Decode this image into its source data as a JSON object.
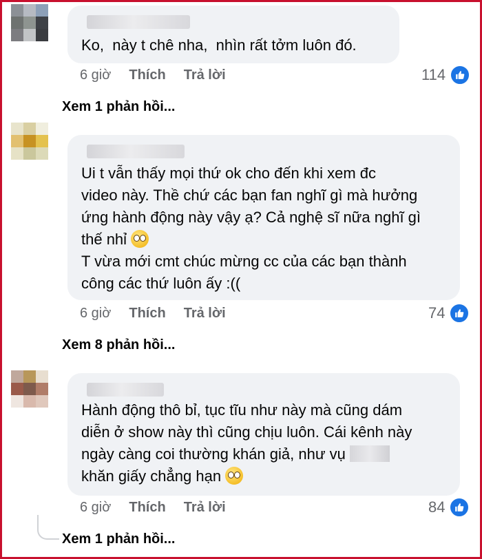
{
  "comments": [
    {
      "text": "Ko,  này t chê nha,  nhìn rất tởm luôn đó.",
      "time": "6 giờ",
      "like": "Thích",
      "reply": "Trả lời",
      "reaction_count": "114",
      "view_replies": "Xem 1 phản hồi..."
    },
    {
      "text": "Ui t vẫn thấy mọi thứ ok cho đến khi xem đc\nvideo này. Thề chứ các bạn fan nghĩ gì mà hưởng\nứng hành động này vậy ạ? Cả nghệ sĩ nữa nghĩ gì\nthế nhỉ",
      "text_line2": "T vừa mới cmt chúc mừng cc của các bạn thành\ncông các thứ luôn ấy :((",
      "emoji": "pleading-face-emoji",
      "time": "6 giờ",
      "like": "Thích",
      "reply": "Trả lời",
      "reaction_count": "74",
      "view_replies": "Xem 8 phản hồi..."
    },
    {
      "text_a": "Hành động thô bỉ, tục tĩu như này mà cũng dám\ndiễn ở show này thì cũng chịu luôn. Cái kênh này\nngày càng coi thường khán giả, như vụ ",
      "text_b": "\nkhăn giấy chẳng hạn ",
      "emoji": "flushed-face-emoji",
      "time": "6 giờ",
      "like": "Thích",
      "reply": "Trả lời",
      "reaction_count": "84",
      "view_replies": "Xem 1 phản hồi..."
    }
  ],
  "reaction_icon": "like-thumb-icon",
  "colors": {
    "frame": "#c8102e",
    "bubble": "#f0f2f5",
    "like": "#1b74e4",
    "meta": "#65676b"
  }
}
